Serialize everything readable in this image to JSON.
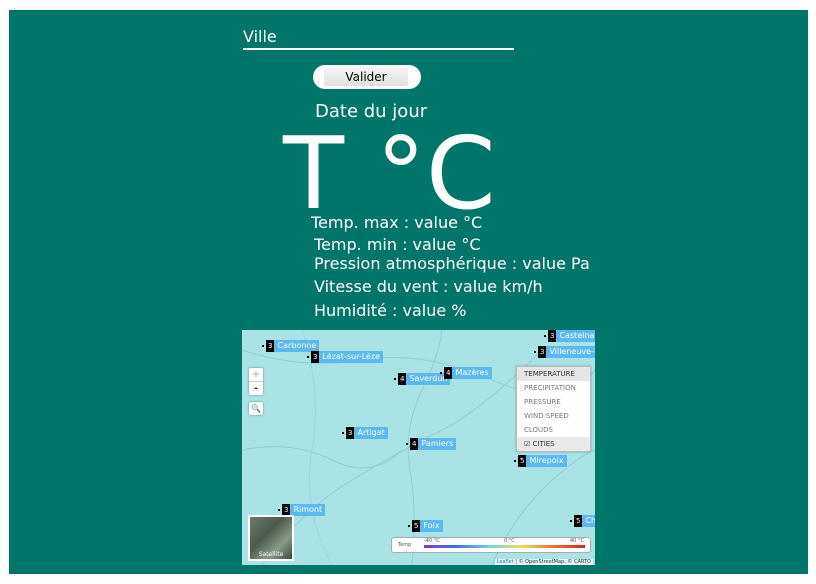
{
  "form": {
    "city_placeholder": "Ville",
    "submit_label": "Valider"
  },
  "weather": {
    "date": "Date du jour",
    "temperature": "T °C",
    "temp_max": "Temp. max : value °C",
    "temp_min": "Temp. min : value °C",
    "pressure": "Pression atmosphérique : value Pa",
    "wind": "Vitesse du vent : value km/h",
    "humidity": "Humidité : value %"
  },
  "map": {
    "cities": [
      {
        "num": "3",
        "name": "Carbonne"
      },
      {
        "num": "3",
        "name": "Lézat-sur-Lèze"
      },
      {
        "num": "4",
        "name": "Saverdun"
      },
      {
        "num": "4",
        "name": "Mazères"
      },
      {
        "num": "3",
        "name": "Castelna"
      },
      {
        "num": "3",
        "name": "Villeneuve-l"
      },
      {
        "num": "3",
        "name": "Artigat"
      },
      {
        "num": "4",
        "name": "Pamiers"
      },
      {
        "num": "5",
        "name": "Mirepoix"
      },
      {
        "num": "3",
        "name": "Rimont"
      },
      {
        "num": "5",
        "name": "Foix"
      },
      {
        "num": "5",
        "name": "Ch"
      }
    ],
    "zoom_in": "+",
    "zoom_out": "-",
    "layers": [
      "TEMPERATURE",
      "PRECIPITATION",
      "PRESSURE",
      "WIND SPEED",
      "CLOUDS",
      "CITIES"
    ],
    "satellite_label": "Satellite",
    "legend": {
      "label": "Temp",
      "min": "-40 °C",
      "mid": "0 °C",
      "max": "40 °C"
    },
    "attribution_leaflet": "Leaflet",
    "attribution_rest": "| © OpenStreetMap, © CARTO"
  },
  "colors": {
    "panel": "#00766a",
    "map_water": "#a9e3e6",
    "city_label": "#5bb8f0"
  }
}
